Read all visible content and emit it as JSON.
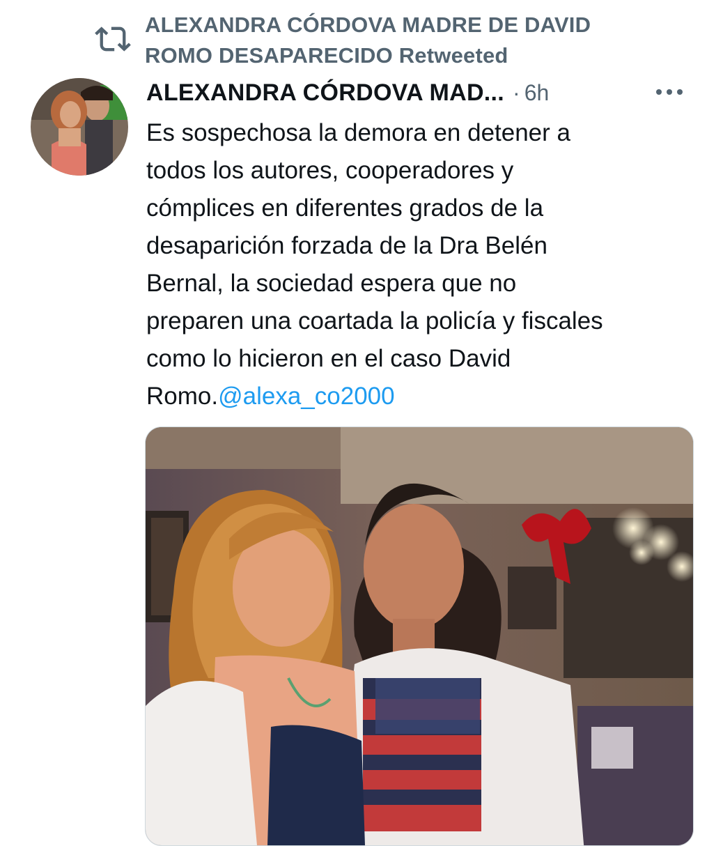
{
  "retweet": {
    "icon": "retweet-icon",
    "line1": "ALEXANDRA CÓRDOVA MADRE DE DAVID",
    "line2": "ROMO DESAPARECIDO Retweeted"
  },
  "tweet": {
    "author_name": "ALEXANDRA CÓRDOVA MAD...",
    "separator": "·",
    "time": "6h",
    "more_icon": "more-horizontal-icon",
    "body_lines": [
      "Es sospechosa la demora en detener a",
      "todos los autores, cooperadores y",
      "cómplices en diferentes grados de la",
      "desaparición forzada de la Dra Belén",
      "Bernal, la sociedad espera que no",
      "preparen una coartada la policía y fiscales",
      "como lo hicieron en el caso David",
      "Romo."
    ],
    "mention": "@alexa_co2000",
    "media_icon": "photo-mother-and-son"
  },
  "colors": {
    "secondary_text": "#536471",
    "link": "#1d9bf0",
    "text": "#0f1419"
  }
}
